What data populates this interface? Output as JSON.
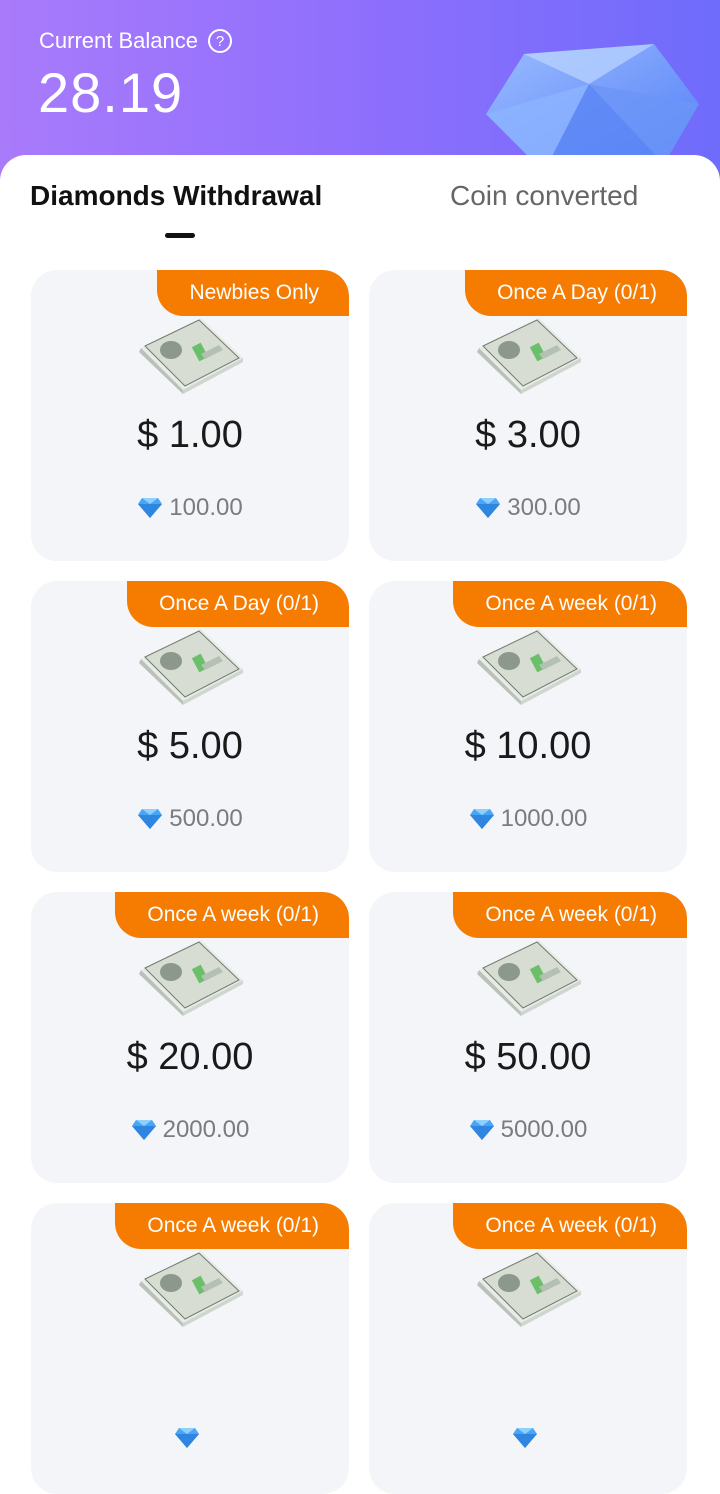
{
  "header": {
    "balance_label": "Current Balance",
    "help_icon": "question-circle-icon",
    "balance_value": "28.19",
    "decoration_icon": "diamond-icon"
  },
  "tabs": [
    {
      "label": "Diamonds Withdrawal",
      "active": true
    },
    {
      "label": "Coin converted",
      "active": false
    }
  ],
  "cards": [
    {
      "badge": "Newbies Only",
      "amount": "$ 1.00",
      "cost": "100.00"
    },
    {
      "badge": "Once A Day (0/1)",
      "amount": "$ 3.00",
      "cost": "300.00"
    },
    {
      "badge": "Once A Day (0/1)",
      "amount": "$ 5.00",
      "cost": "500.00"
    },
    {
      "badge": "Once A week (0/1)",
      "amount": "$ 10.00",
      "cost": "1000.00"
    },
    {
      "badge": "Once A week (0/1)",
      "amount": "$ 20.00",
      "cost": "2000.00"
    },
    {
      "badge": "Once A week (0/1)",
      "amount": "$ 50.00",
      "cost": "5000.00"
    },
    {
      "badge": "Once A week (0/1)",
      "amount": "",
      "cost": ""
    },
    {
      "badge": "Once A week (0/1)",
      "amount": "",
      "cost": ""
    }
  ],
  "colors": {
    "accent_orange": "#f57c00",
    "header_gradient_start": "#a97bfb",
    "header_gradient_end": "#6f6cfb",
    "card_background": "#f4f5f9"
  }
}
